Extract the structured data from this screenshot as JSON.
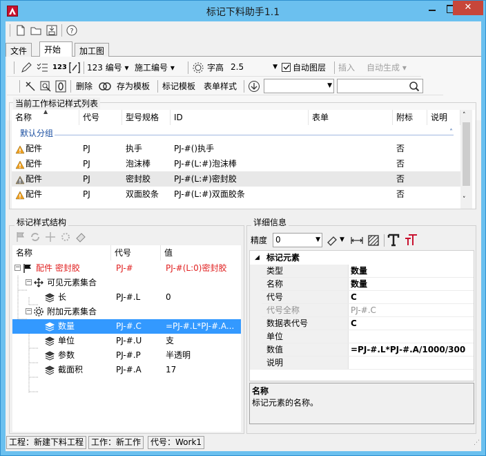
{
  "window": {
    "title": "标记下料助手1.1",
    "close_glyph": "✕"
  },
  "tabs": [
    "文件",
    "开始",
    "加工图"
  ],
  "toolbar": {
    "btn_123": "123",
    "numbering": "123 编号",
    "construction_numbering": "施工编号",
    "char_height_label": "字高",
    "char_height_value": "2.5",
    "auto_layer_label": "自动图层",
    "auto_layer_checked": true,
    "insert_label": "插入",
    "auto_generate_label": "自动生成",
    "delete_label": "删除",
    "save_template_label": "存为模板",
    "mark_template_label": "标记模板",
    "form_style_label": "表单样式",
    "template_select_value": "",
    "search_value": ""
  },
  "style_list": {
    "group_title": "当前工作标记样式列表",
    "columns": [
      "名称",
      "代号",
      "型号规格",
      "ID",
      "表单",
      "附标",
      "说明"
    ],
    "group_name": "默认分组",
    "rows": [
      {
        "name": "配件",
        "code": "PJ",
        "spec": "执手",
        "id": "PJ-#()执手",
        "form": "",
        "sub": "否",
        "note": ""
      },
      {
        "name": "配件",
        "code": "PJ",
        "spec": "泡沫棒",
        "id": "PJ-#(L:#)泡沫棒",
        "form": "",
        "sub": "否",
        "note": ""
      },
      {
        "name": "配件",
        "code": "PJ",
        "spec": "密封胶",
        "id": "PJ-#(L:#)密封胶",
        "form": "",
        "sub": "否",
        "note": ""
      },
      {
        "name": "配件",
        "code": "PJ",
        "spec": "双面胶条",
        "id": "PJ-#(L:#)双面胶条",
        "form": "",
        "sub": "否",
        "note": ""
      }
    ]
  },
  "structure": {
    "group_title": "标记样式结构",
    "columns": [
      "名称",
      "代号",
      "值"
    ],
    "nodes": [
      {
        "label": "配件 密封胶",
        "code": "PJ-#",
        "value": "PJ-#(L:0)密封胶"
      },
      {
        "label": "可见元素集合",
        "code": "",
        "value": ""
      },
      {
        "label": "长",
        "code": "PJ-#.L",
        "value": "0"
      },
      {
        "label": "附加元素集合",
        "code": "",
        "value": ""
      },
      {
        "label": "数量",
        "code": "PJ-#.C",
        "value": "=PJ-#.L*PJ-#.A..."
      },
      {
        "label": "单位",
        "code": "PJ-#.U",
        "value": "支"
      },
      {
        "label": "参数",
        "code": "PJ-#.P",
        "value": "半透明"
      },
      {
        "label": "截面积",
        "code": "PJ-#.A",
        "value": "17"
      }
    ]
  },
  "details": {
    "group_title": "详细信息",
    "precision_label": "精度",
    "precision_value": "0",
    "category": "标记元素",
    "props": [
      {
        "k": "类型",
        "v": "数量"
      },
      {
        "k": "名称",
        "v": "数量"
      },
      {
        "k": "代号",
        "v": "C"
      },
      {
        "k": "代号全称",
        "v": "PJ-#.C"
      },
      {
        "k": "数据表代号",
        "v": "C"
      },
      {
        "k": "单位",
        "v": ""
      },
      {
        "k": "数值",
        "v": "=PJ-#.L*PJ-#.A/1000/300"
      },
      {
        "k": "说明",
        "v": ""
      }
    ],
    "desc_title": "名称",
    "desc_text": "标记元素的名称。"
  },
  "status": {
    "project": "工程：新建下料工程",
    "work": "工作：新工作",
    "code": "代号：Work1"
  },
  "colors": {
    "title_bar": "#6bc0ef",
    "close": "#c7463a",
    "selection": "#3399ff",
    "red_text": "#e02020",
    "warn": "#f0a020"
  }
}
